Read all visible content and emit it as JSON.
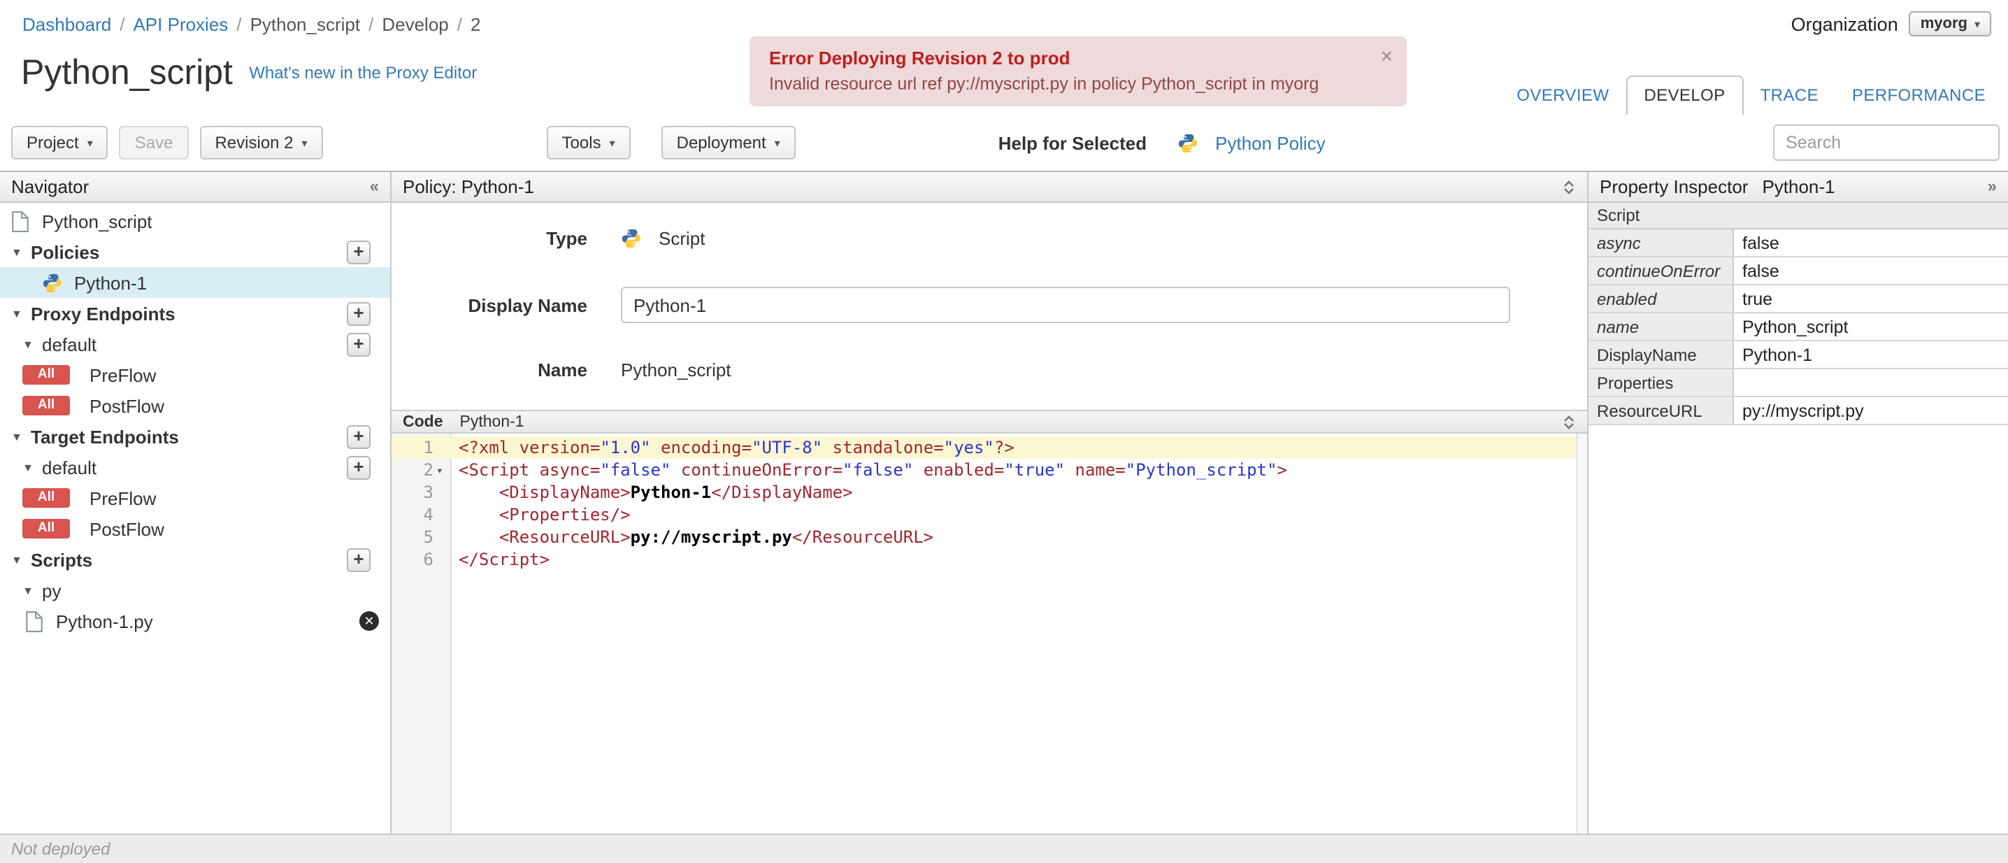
{
  "breadcrumb": {
    "items": [
      "Dashboard",
      "API Proxies",
      "Python_script",
      "Develop",
      "2"
    ],
    "separator": "/"
  },
  "organization": {
    "label": "Organization",
    "value": "myorg"
  },
  "error_banner": {
    "title": "Error Deploying Revision 2 to prod",
    "message": "Invalid resource url ref py://myscript.py in policy Python_script in myorg",
    "close_label": "×"
  },
  "page": {
    "title": "Python_script",
    "whats_new_link": "What's new in the Proxy Editor"
  },
  "tabs": {
    "overview": "OVERVIEW",
    "develop": "DEVELOP",
    "trace": "TRACE",
    "performance": "PERFORMANCE"
  },
  "toolbar": {
    "project": "Project",
    "save": "Save",
    "revision": "Revision 2",
    "tools": "Tools",
    "deployment": "Deployment",
    "help_for_selected": "Help for Selected",
    "policy_link": "Python Policy",
    "search_placeholder": "Search"
  },
  "navigator": {
    "title": "Navigator",
    "collapse_glyph": "«",
    "root_item": "Python_script",
    "policies": {
      "label": "Policies",
      "item": "Python-1"
    },
    "proxy_endpoints": {
      "label": "Proxy Endpoints",
      "group": "default",
      "flows": [
        {
          "badge": "All",
          "label": "PreFlow"
        },
        {
          "badge": "All",
          "label": "PostFlow"
        }
      ]
    },
    "target_endpoints": {
      "label": "Target Endpoints",
      "group": "default",
      "flows": [
        {
          "badge": "All",
          "label": "PreFlow"
        },
        {
          "badge": "All",
          "label": "PostFlow"
        }
      ]
    },
    "scripts": {
      "label": "Scripts",
      "group": "py",
      "file": "Python-1.py",
      "delete_glyph": "✕"
    }
  },
  "policy_panel": {
    "title": "Policy: Python-1",
    "form": {
      "type_label": "Type",
      "type_value": "Script",
      "display_name_label": "Display Name",
      "display_name_value": "Python-1",
      "name_label": "Name",
      "name_value": "Python_script"
    },
    "code": {
      "label": "Code",
      "file": "Python-1",
      "lines": [
        {
          "n": 1,
          "active": true,
          "tokens": [
            {
              "t": "tag",
              "s": "<?xml "
            },
            {
              "t": "attr",
              "s": "version="
            },
            {
              "t": "str",
              "s": "\"1.0\""
            },
            {
              "t": "attr",
              "s": " encoding="
            },
            {
              "t": "str",
              "s": "\"UTF-8\""
            },
            {
              "t": "attr",
              "s": " standalone="
            },
            {
              "t": "str",
              "s": "\"yes\""
            },
            {
              "t": "tag",
              "s": "?>"
            }
          ]
        },
        {
          "n": 2,
          "fold": true,
          "tokens": [
            {
              "t": "tag",
              "s": "<Script "
            },
            {
              "t": "attr",
              "s": "async="
            },
            {
              "t": "str",
              "s": "\"false\""
            },
            {
              "t": "attr",
              "s": " continueOnError="
            },
            {
              "t": "str",
              "s": "\"false\""
            },
            {
              "t": "attr",
              "s": " enabled="
            },
            {
              "t": "str",
              "s": "\"true\""
            },
            {
              "t": "attr",
              "s": " name="
            },
            {
              "t": "str",
              "s": "\"Python_script\""
            },
            {
              "t": "tag",
              "s": ">"
            }
          ]
        },
        {
          "n": 3,
          "tokens": [
            {
              "t": "plain",
              "s": "    "
            },
            {
              "t": "tag",
              "s": "<DisplayName>"
            },
            {
              "t": "text",
              "s": "Python-1"
            },
            {
              "t": "tag",
              "s": "</DisplayName>"
            }
          ]
        },
        {
          "n": 4,
          "tokens": [
            {
              "t": "plain",
              "s": "    "
            },
            {
              "t": "tag",
              "s": "<Properties/>"
            }
          ]
        },
        {
          "n": 5,
          "tokens": [
            {
              "t": "plain",
              "s": "    "
            },
            {
              "t": "tag",
              "s": "<ResourceURL>"
            },
            {
              "t": "text",
              "s": "py://myscript.py"
            },
            {
              "t": "tag",
              "s": "</ResourceURL>"
            }
          ]
        },
        {
          "n": 6,
          "tokens": [
            {
              "t": "tag",
              "s": "</Script>"
            }
          ]
        }
      ]
    }
  },
  "inspector": {
    "title": "Property Inspector",
    "subtitle": "Python-1",
    "expand_glyph": "»",
    "section": "Script",
    "rows": [
      {
        "key": "async",
        "value": "false",
        "italic": true
      },
      {
        "key": "continueOnError",
        "value": "false",
        "italic": true
      },
      {
        "key": "enabled",
        "value": "true",
        "italic": true
      },
      {
        "key": "name",
        "value": "Python_script",
        "italic": true
      },
      {
        "key": "DisplayName",
        "value": "Python-1",
        "italic": false
      },
      {
        "key": "Properties",
        "value": "",
        "italic": false
      },
      {
        "key": "ResourceURL",
        "value": "py://myscript.py",
        "italic": false
      }
    ]
  },
  "statusbar": {
    "text": "Not deployed"
  }
}
